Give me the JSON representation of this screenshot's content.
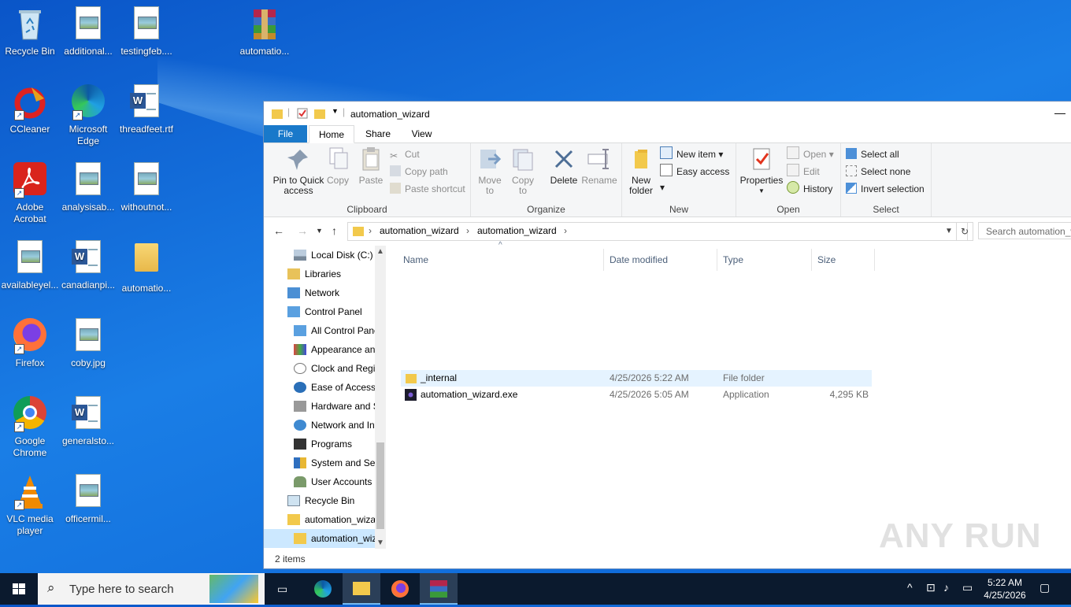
{
  "desktop": {
    "icons": [
      {
        "label": "Recycle Bin"
      },
      {
        "label": "additional..."
      },
      {
        "label": "testingfeb...."
      },
      {
        "label": "automatio..."
      },
      {
        "label": "CCleaner"
      },
      {
        "label": "Microsoft Edge"
      },
      {
        "label": "threadfeet.rtf"
      },
      {
        "label": "Adobe Acrobat"
      },
      {
        "label": "analysisab..."
      },
      {
        "label": "withoutnot..."
      },
      {
        "label": "availableyel..."
      },
      {
        "label": "canadianpi..."
      },
      {
        "label": "automatio..."
      },
      {
        "label": "Firefox"
      },
      {
        "label": "coby.jpg"
      },
      {
        "label": "Google Chrome"
      },
      {
        "label": "generalsto..."
      },
      {
        "label": "VLC media player"
      },
      {
        "label": "officermil..."
      }
    ]
  },
  "explorer": {
    "title": "automation_wizard",
    "tabs": [
      "File",
      "Home",
      "Share",
      "View"
    ],
    "ribbon": {
      "clipboard": {
        "label": "Clipboard",
        "pin": "Pin to Quick access",
        "copy": "Copy",
        "paste": "Paste",
        "cut": "Cut",
        "copy_path": "Copy path",
        "paste_shortcut": "Paste shortcut"
      },
      "organize": {
        "label": "Organize",
        "move_to": "Move to",
        "copy_to": "Copy to",
        "delete": "Delete",
        "rename": "Rename"
      },
      "new": {
        "label": "New",
        "new_folder": "New folder",
        "new_item": "New item",
        "easy_access": "Easy access"
      },
      "open": {
        "label": "Open",
        "properties": "Properties",
        "open": "Open",
        "edit": "Edit",
        "history": "History"
      },
      "select": {
        "label": "Select",
        "select_all": "Select all",
        "select_none": "Select none",
        "invert_selection": "Invert selection"
      }
    },
    "address": {
      "crumbs": [
        "automation_wizard",
        "automation_wizard"
      ],
      "search_placeholder": "Search automation_wizard"
    },
    "nav": [
      {
        "label": "Local Disk (C:)"
      },
      {
        "label": "Libraries"
      },
      {
        "label": "Network"
      },
      {
        "label": "Control Panel"
      },
      {
        "label": "All Control Panel Items"
      },
      {
        "label": "Appearance and Personalization"
      },
      {
        "label": "Clock and Region"
      },
      {
        "label": "Ease of Access"
      },
      {
        "label": "Hardware and Sound"
      },
      {
        "label": "Network and Internet"
      },
      {
        "label": "Programs"
      },
      {
        "label": "System and Security"
      },
      {
        "label": "User Accounts"
      },
      {
        "label": "Recycle Bin"
      },
      {
        "label": "automation_wizard"
      },
      {
        "label": "automation_wizard"
      }
    ],
    "columns": {
      "name": "Name",
      "date": "Date modified",
      "type": "Type",
      "size": "Size"
    },
    "files": [
      {
        "name": "_internal",
        "date": "4/25/2026 5:22 AM",
        "type": "File folder",
        "size": ""
      },
      {
        "name": "automation_wizard.exe",
        "date": "4/25/2026 5:05 AM",
        "type": "Application",
        "size": "4,295 KB"
      }
    ],
    "status": "2 items"
  },
  "watermark": "ANY RUN",
  "taskbar": {
    "search_placeholder": "Type here to search",
    "time": "5:22 AM",
    "date": "4/25/2026"
  },
  "colors": {
    "accent": "#1979ca",
    "selection": "#cce8ff",
    "hover": "#e5f3ff"
  }
}
